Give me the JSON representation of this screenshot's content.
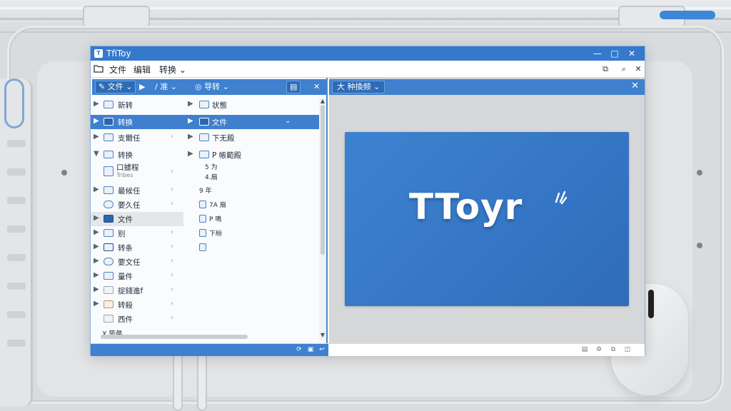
{
  "window": {
    "app_icon_text": "T",
    "title": "TfiToy",
    "minimize_glyph": "—",
    "maximize_glyph": "□",
    "close_glyph": "✕"
  },
  "menubar": {
    "items": [
      "文件",
      "编辑",
      "转换 ⌄"
    ],
    "right_icons": [
      "restore-icon",
      "search-icon",
      "close-icon"
    ]
  },
  "left_toolbar": {
    "file_btn": "文件",
    "convert_btn": "/ 准 ⌄",
    "export_btn": "导转 ⌄",
    "panel_glyph": "▤",
    "close_glyph": "✕"
  },
  "tree": {
    "col1": [
      {
        "arrow": "▶",
        "label": "新转"
      },
      {
        "arrow": "▶",
        "label": "转换",
        "selected": true
      },
      {
        "arrow": "▶",
        "label": "支爾任"
      },
      {
        "arrow": "▼",
        "label": "转换"
      },
      {
        "arrow": "",
        "label": "口據程",
        "sub": "Tribes"
      },
      {
        "arrow": "▶",
        "label": "最候任"
      },
      {
        "arrow": "",
        "label": "要久任"
      },
      {
        "arrow": "▶",
        "label": "文件",
        "highlight": true
      },
      {
        "arrow": "▶",
        "label": "别"
      },
      {
        "arrow": "▶",
        "label": "转条"
      },
      {
        "arrow": "▶",
        "label": "要文任"
      },
      {
        "arrow": "▶",
        "label": "量件"
      },
      {
        "arrow": "▶",
        "label": "捉錢進f"
      },
      {
        "arrow": "▶",
        "label": "转殺"
      },
      {
        "arrow": "",
        "label": "西件"
      },
      {
        "arrow": "",
        "label": "X 築最"
      }
    ],
    "col2": [
      {
        "arrow": "▶",
        "label": "状態"
      },
      {
        "arrow": "▶",
        "label": "文件",
        "selected": true
      },
      {
        "arrow": "▶",
        "label": "下无殿"
      },
      {
        "arrow": "▶",
        "label": "P 帳範殿"
      },
      {
        "arrow": "",
        "label": "5 为"
      },
      {
        "arrow": "",
        "label": "4.扇"
      },
      {
        "arrow": "",
        "label": "9 年"
      },
      {
        "arrow": "",
        "label": "7A 扇"
      },
      {
        "arrow": "",
        "label": "P 鳴"
      },
      {
        "arrow": "",
        "label": "下紛"
      },
      {
        "arrow": "",
        "label": ""
      }
    ]
  },
  "right_toolbar": {
    "tab_label": "大 种換频 ⌄",
    "close_glyph": "✕"
  },
  "preview": {
    "logo_text": "TToyr"
  },
  "statusbar": {
    "left_icons": [
      "refresh-icon",
      "save-icon",
      "back-icon"
    ],
    "right_icons": [
      "image-icon",
      "settings-icon",
      "crop-icon",
      "layout-icon"
    ]
  }
}
